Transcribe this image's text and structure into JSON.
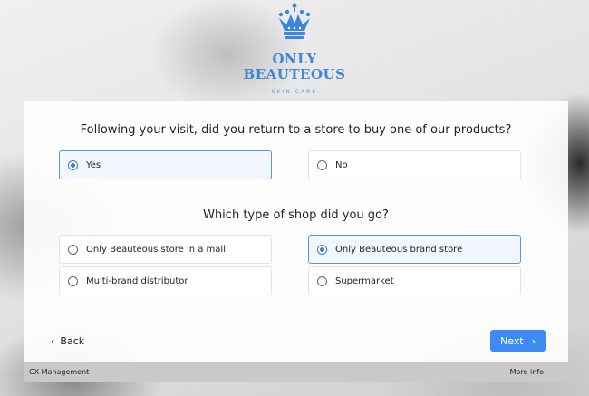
{
  "header": {
    "brand_line1": "ONLY",
    "brand_line2": "BEAUTEOUS",
    "tagline": "SKIN CARE",
    "logo_icon": "crown-icon",
    "brand_color": "#3c86dd"
  },
  "survey": {
    "question1": {
      "text": "Following your visit, did you return to a store to buy one of our products?",
      "options": [
        {
          "label": "Yes",
          "selected": true
        },
        {
          "label": "No",
          "selected": false
        }
      ]
    },
    "question2": {
      "text": "Which type of shop did you go?",
      "options": [
        {
          "label": "Only Beauteous store in a mall",
          "selected": false
        },
        {
          "label": "Only Beauteous brand store",
          "selected": true
        },
        {
          "label": "Multi-brand distributor",
          "selected": false
        },
        {
          "label": "Supermarket",
          "selected": false
        }
      ]
    }
  },
  "nav": {
    "back_label": "Back",
    "next_label": "Next",
    "next_color": "#3d8bf2"
  },
  "footer": {
    "left_text": "CX Management",
    "right_text": "More info"
  }
}
